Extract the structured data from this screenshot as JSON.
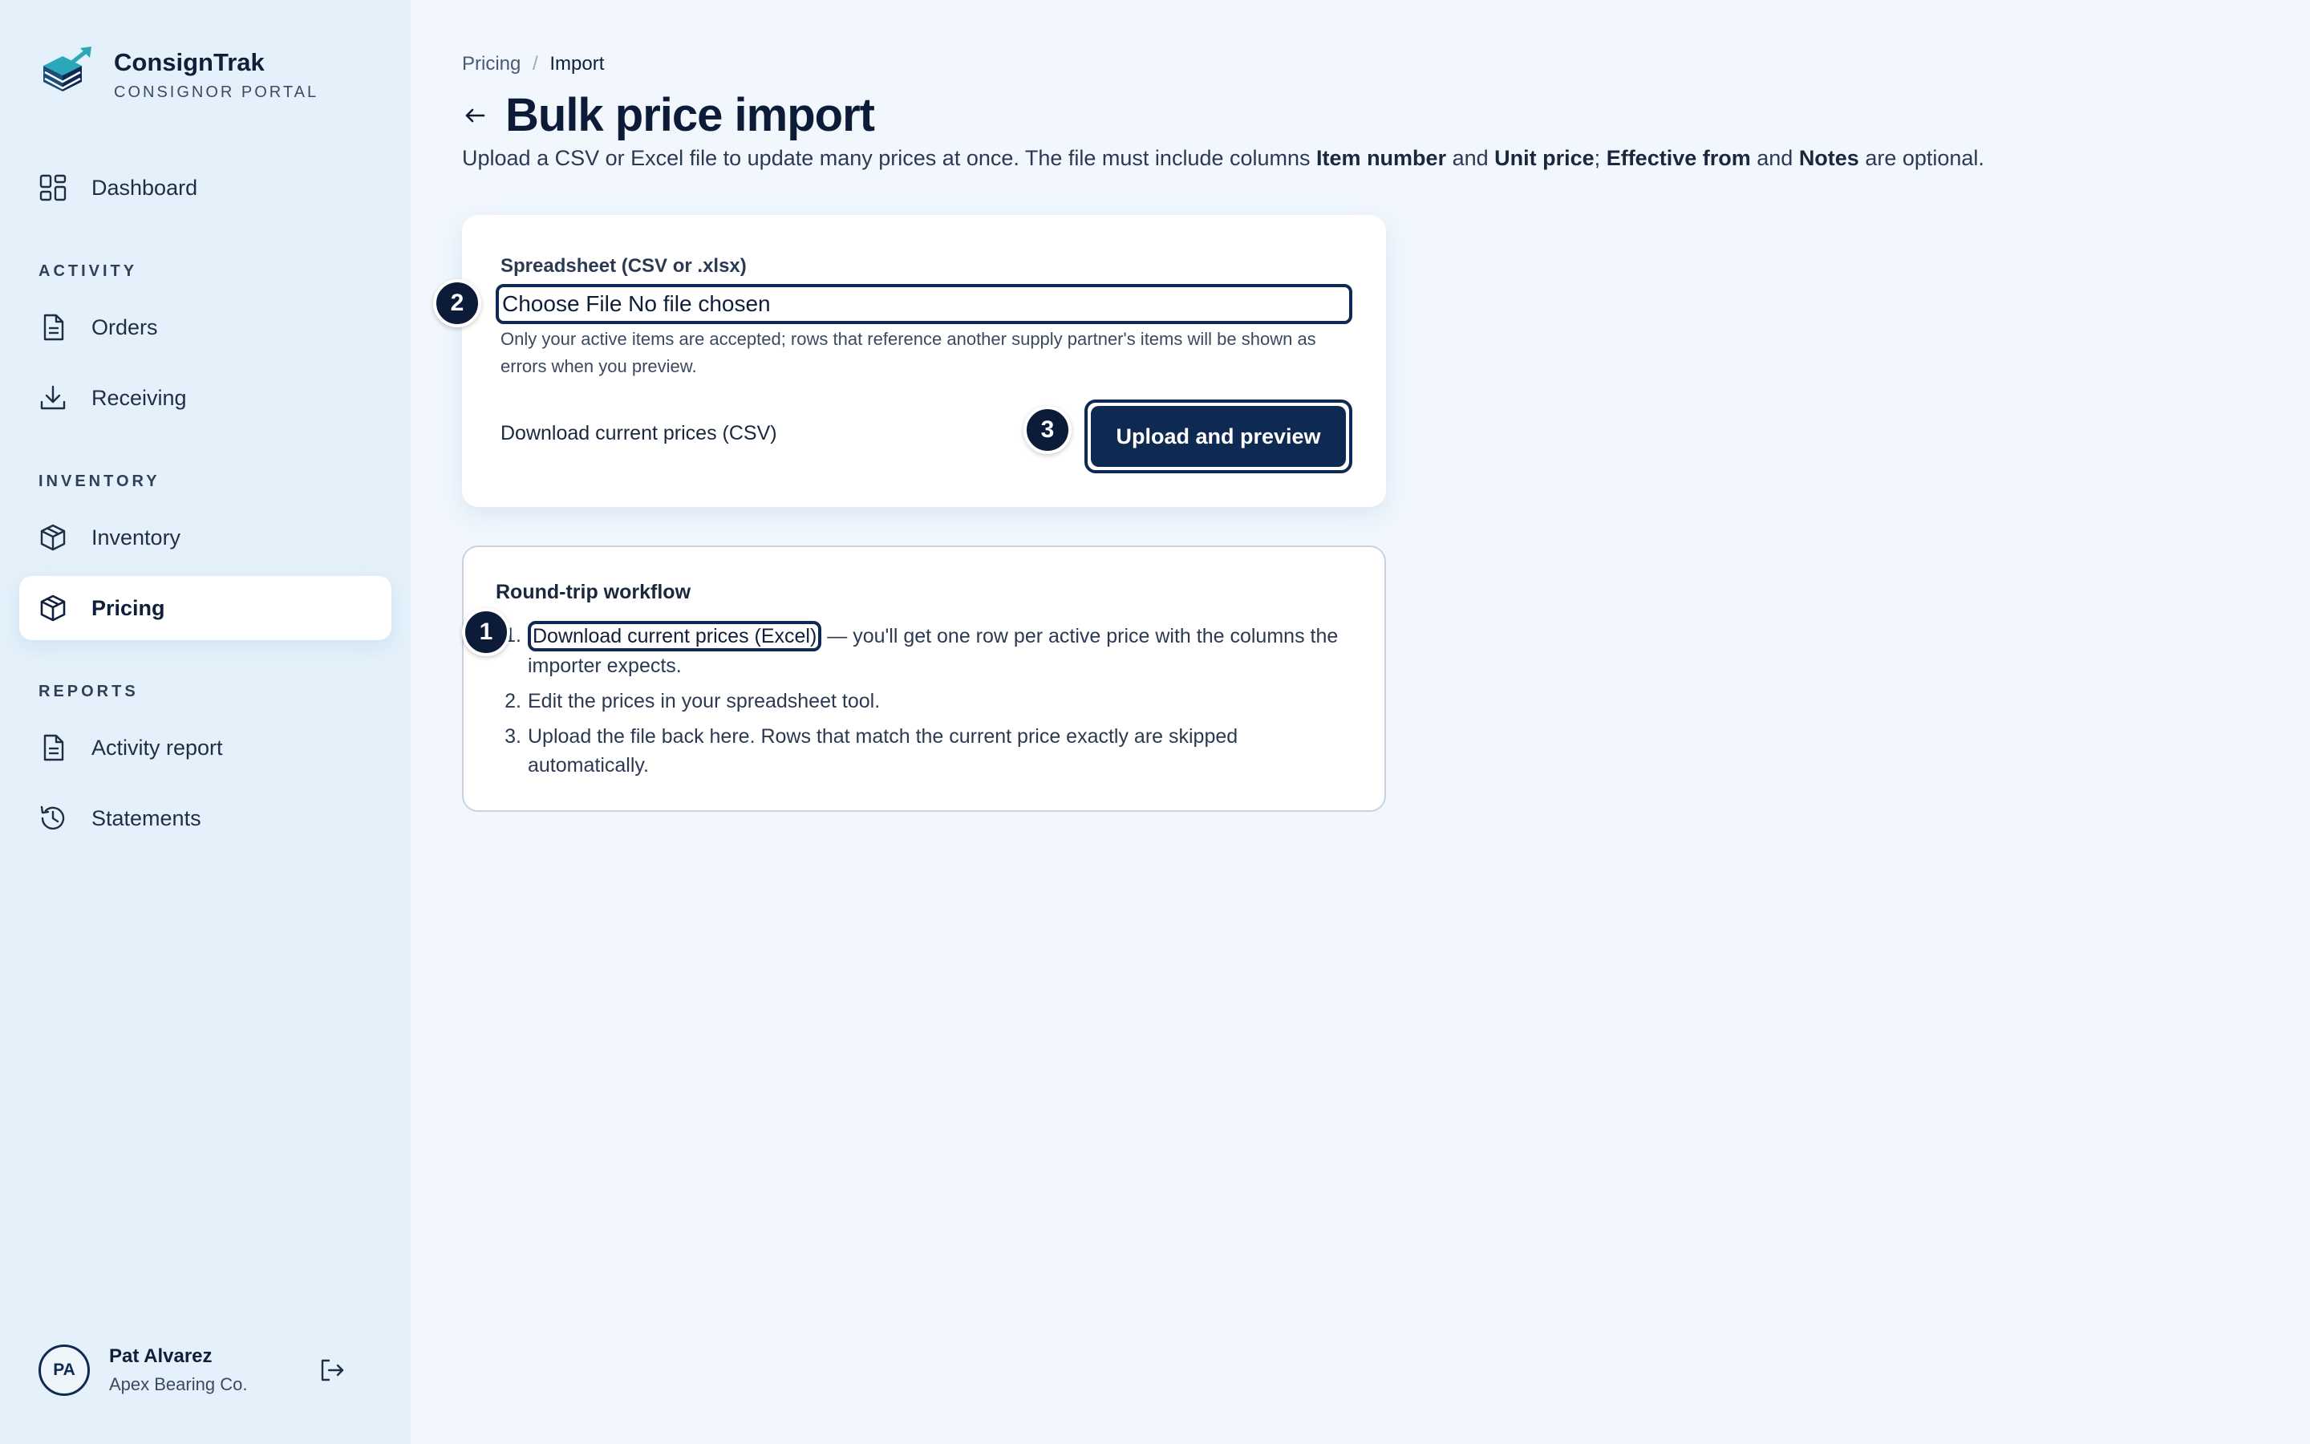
{
  "brand": {
    "name": "ConsignTrak",
    "subtitle": "CONSIGNOR PORTAL"
  },
  "sidebar": {
    "dashboard": "Dashboard",
    "sections": {
      "activity": "ACTIVITY",
      "inventory": "INVENTORY",
      "reports": "REPORTS"
    },
    "items": {
      "orders": "Orders",
      "receiving": "Receiving",
      "inventory": "Inventory",
      "pricing": "Pricing",
      "activity_report": "Activity report",
      "statements": "Statements"
    },
    "active": "Pricing"
  },
  "user": {
    "initials": "PA",
    "name": "Pat Alvarez",
    "org": "Apex Bearing Co."
  },
  "breadcrumb": {
    "parent": "Pricing",
    "separator": "/",
    "current": "Import"
  },
  "page": {
    "title": "Bulk price import",
    "desc_1": "Upload a CSV or Excel file to update many prices at once. The file must include columns ",
    "col_item_number": "Item number",
    "desc_and_1": " and ",
    "col_unit_price": "Unit price",
    "desc_sep": "; ",
    "col_effective_from": "Effective from",
    "desc_and_2": " and ",
    "col_notes": "Notes",
    "desc_end": " are optional."
  },
  "upload": {
    "field_label": "Spreadsheet (CSV or .xlsx)",
    "file_input_text": "Choose File No file chosen",
    "help": "Only your active items are accepted; rows that reference another supply partner's items will be shown as errors when you preview.",
    "download_csv": "Download current prices (CSV)",
    "submit": "Upload and preview"
  },
  "workflow": {
    "title": "Round-trip workflow",
    "step1_num": "1.",
    "step1_link": "Download current prices (Excel)",
    "step1_text": " — you'll get one row per active price with the columns the importer expects.",
    "step2_num": "2.",
    "step2_text": "Edit the prices in your spreadsheet tool.",
    "step3_num": "3.",
    "step3_text": "Upload the file back here. Rows that match the current price exactly are skipped automatically."
  },
  "badges": {
    "one": "1",
    "two": "2",
    "three": "3"
  },
  "colors": {
    "primary": "#0f2a52",
    "sidebar_bg": "#e4f1fb",
    "main_bg": "#f1f7fd",
    "accent_teal": "#2aa7b8"
  }
}
